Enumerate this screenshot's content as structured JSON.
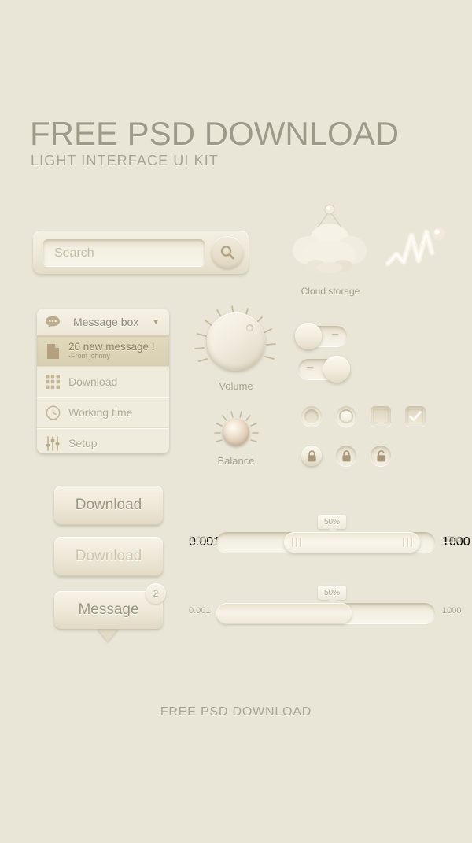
{
  "header": {
    "title": "FREE PSD DOWNLOAD",
    "subtitle": "LIGHT INTERFACE UI KIT"
  },
  "footer": {
    "text": "FREE PSD DOWNLOAD"
  },
  "colors": {
    "background": "#e9e6d8",
    "panel": "#efebdd",
    "text_muted": "#a39c86",
    "text_heading": "#9d9a88",
    "accent_icon": "#b9a98c",
    "highlight_row": "#ded5b9"
  },
  "search": {
    "placeholder": "Search",
    "value": "",
    "button_icon": "search-icon"
  },
  "message_box": {
    "header": {
      "label": "Message box",
      "icon": "chat-bubble-icon",
      "chevron": "▼"
    },
    "items": [
      {
        "title": "20 new message !",
        "subtitle": "-From johnny",
        "icon": "document-icon",
        "selected": true
      },
      {
        "title": "Download",
        "subtitle": "",
        "icon": "grid-icon",
        "selected": false
      },
      {
        "title": "Working time",
        "subtitle": "",
        "icon": "clock-icon",
        "selected": false
      },
      {
        "title": "Setup",
        "subtitle": "",
        "icon": "sliders-icon",
        "selected": false
      }
    ]
  },
  "cloud": {
    "label": "Cloud storage",
    "icon": "cloud-icon"
  },
  "chart_icon": {
    "icon": "zigzag-chart-icon"
  },
  "knobs": [
    {
      "name": "volume",
      "label": "Volume",
      "indicator": "dot"
    },
    {
      "name": "balance",
      "label": "Balance",
      "indicator": "pearl"
    }
  ],
  "toggles": [
    {
      "name": "toggle-off",
      "state": "off"
    },
    {
      "name": "toggle-on",
      "state": "on"
    }
  ],
  "controls": [
    {
      "name": "radio-unselected",
      "type": "radio",
      "checked": false
    },
    {
      "name": "radio-selected",
      "type": "radio",
      "checked": true
    },
    {
      "name": "checkbox-unchecked",
      "type": "checkbox",
      "checked": false
    },
    {
      "name": "checkbox-checked",
      "type": "checkbox",
      "checked": true
    }
  ],
  "locks": [
    {
      "name": "lock-closed-raised",
      "icon": "lock-closed-icon",
      "style": "raised"
    },
    {
      "name": "lock-closed-inset",
      "icon": "lock-closed-icon",
      "style": "inset"
    },
    {
      "name": "lock-open-inset",
      "icon": "lock-open-icon",
      "style": "inset"
    }
  ],
  "buttons": {
    "download": "Download",
    "download_disabled": "Download",
    "message": "Message",
    "message_badge": "2"
  },
  "sliders": [
    {
      "name": "range-slider",
      "min_label": "0.001",
      "max_label": "1000",
      "tooltip": "50%",
      "value": 50,
      "type": "range"
    },
    {
      "name": "progress-slider",
      "min_label": "0.001",
      "max_label": "1000",
      "tooltip": "50%",
      "value": 50,
      "type": "progress"
    }
  ]
}
